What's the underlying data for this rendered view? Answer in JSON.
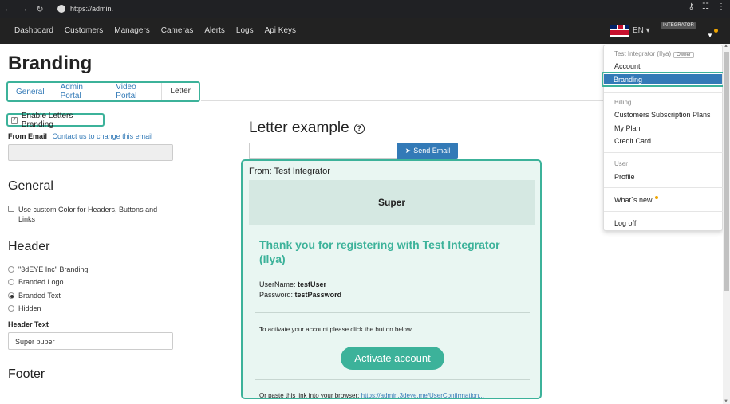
{
  "browser": {
    "url": "https://admin.",
    "icons": [
      "back-icon",
      "forward-icon",
      "reload-icon",
      "key-icon",
      "extension-icon",
      "menu-icon"
    ]
  },
  "navbar": {
    "links": [
      "Dashboard",
      "Customers",
      "Managers",
      "Cameras",
      "Alerts",
      "Logs",
      "Api Keys"
    ],
    "lang": "EN",
    "role_badge": "INTEGRATOR"
  },
  "page": {
    "title": "Branding",
    "tabs": [
      "General",
      "Admin Portal",
      "Video Portal",
      "Letter"
    ],
    "active_tab": "Letter",
    "enable_letters_label": "Enable Letters Branding",
    "enable_letters_checked": true,
    "from_email_label": "From Email",
    "from_email_link": "Contact us to change this email",
    "general_heading": "General",
    "custom_color_label": "Use custom Color for Headers, Buttons and Links",
    "header_heading": "Header",
    "header_options": [
      "\"3dEYE Inc\" Branding",
      "Branded Logo",
      "Branded Text",
      "Hidden"
    ],
    "header_selected": "Branded Text",
    "header_text_label": "Header Text",
    "header_text_value": "Super puper",
    "footer_heading": "Footer"
  },
  "letter": {
    "title": "Letter example",
    "send_button": "Send Email",
    "from_line": "From: Test Integrator",
    "brand_text": "Super",
    "thanks": "Thank you for registering with Test Integrator (Ilya)",
    "username_label": "UserName:",
    "username_value": "testUser",
    "password_label": "Password:",
    "password_value": "testPassword",
    "activate_note": "To activate your account please click the button below",
    "activate_button": "Activate account",
    "paste_text": "Or paste this link into your browser:",
    "paste_link": "https://admin.3deye.me/UserConfirmation..."
  },
  "dropdown": {
    "user_name": "Test Integrator (Ilya)",
    "owner_badge": "Owner",
    "account": "Account",
    "branding": "Branding",
    "billing_head": "Billing",
    "subscription_plans": "Customers Subscription Plans",
    "my_plan": "My Plan",
    "credit_card": "Credit Card",
    "user_head": "User",
    "profile": "Profile",
    "whats_new": "What`s new",
    "log_off": "Log off"
  },
  "colors": {
    "accent": "#3cb29a",
    "primary": "#337ab7",
    "navbar": "#222222"
  }
}
